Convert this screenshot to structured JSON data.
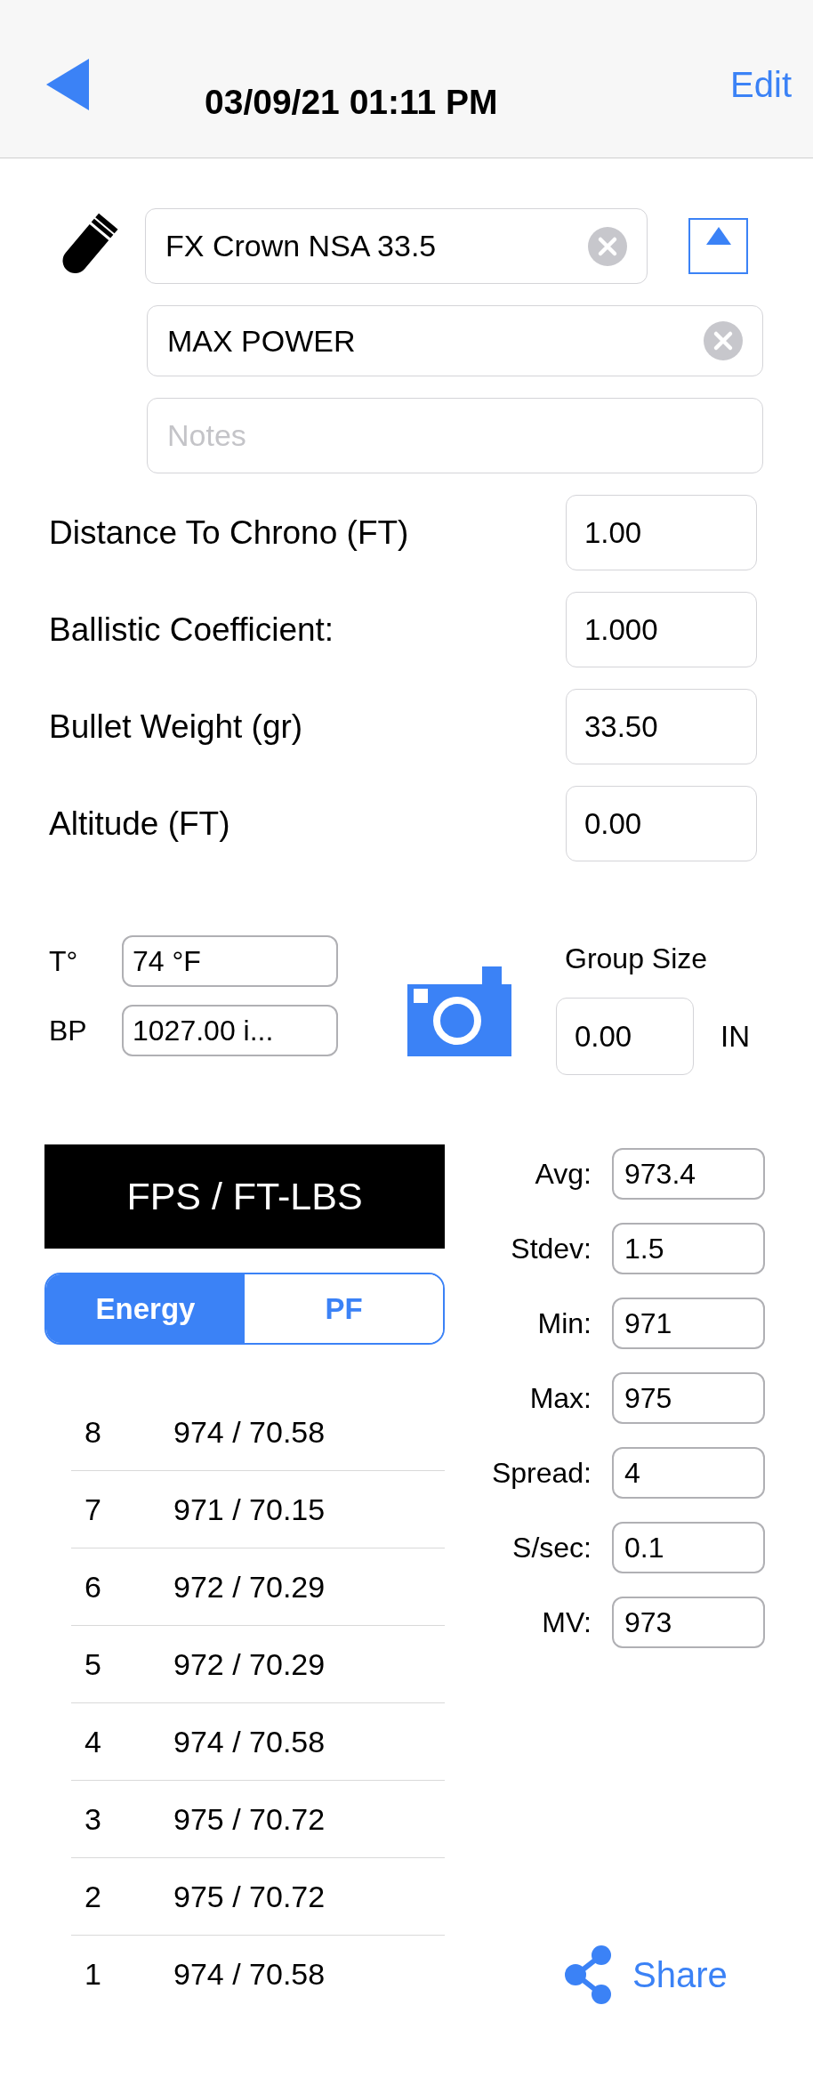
{
  "header": {
    "title": "03/09/21 01:11 PM",
    "action": "Edit"
  },
  "projectile": {
    "name": "FX Crown NSA 33.5",
    "profile": "MAX POWER",
    "notes_placeholder": "Notes"
  },
  "parameters": [
    {
      "label": "Distance To Chrono (FT)",
      "value": "1.00"
    },
    {
      "label": "Ballistic Coefficient:",
      "value": "1.000"
    },
    {
      "label": "Bullet Weight (gr)",
      "value": "33.50"
    },
    {
      "label": "Altitude (FT)",
      "value": "0.00"
    }
  ],
  "conditions": [
    {
      "label": "T°",
      "value": "74 °F"
    },
    {
      "label": "BP",
      "value": "1027.00 i..."
    }
  ],
  "group_size": {
    "label": "Group Size",
    "value": "0.00",
    "unit": "IN"
  },
  "units_banner": "FPS / FT-LBS",
  "mode_tabs": [
    {
      "label": "Energy",
      "selected": true
    },
    {
      "label": "PF",
      "selected": false
    }
  ],
  "shots": [
    {
      "number": "8",
      "reading": "974 / 70.58"
    },
    {
      "number": "7",
      "reading": "971 / 70.15"
    },
    {
      "number": "6",
      "reading": "972 / 70.29"
    },
    {
      "number": "5",
      "reading": "972 / 70.29"
    },
    {
      "number": "4",
      "reading": "974 / 70.58"
    },
    {
      "number": "3",
      "reading": "975 / 70.72"
    },
    {
      "number": "2",
      "reading": "975 / 70.72"
    },
    {
      "number": "1",
      "reading": "974 / 70.58"
    }
  ],
  "stats": [
    {
      "label": "Avg:",
      "value": "973.4"
    },
    {
      "label": "Stdev:",
      "value": "1.5"
    },
    {
      "label": "Min:",
      "value": "971"
    },
    {
      "label": "Max:",
      "value": "975"
    },
    {
      "label": "Spread:",
      "value": "4"
    },
    {
      "label": "S/sec:",
      "value": "0.1"
    },
    {
      "label": "MV:",
      "value": "973"
    }
  ],
  "share": "Share"
}
